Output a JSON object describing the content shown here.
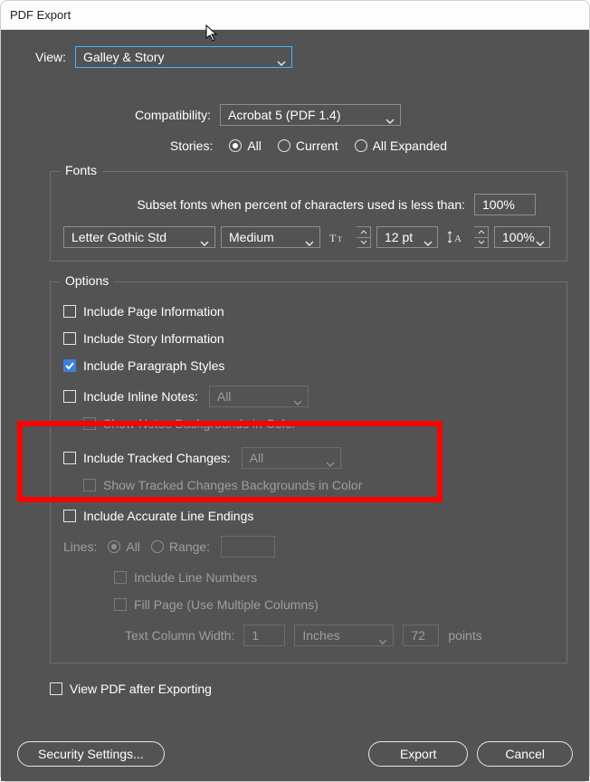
{
  "window": {
    "title": "PDF Export"
  },
  "view": {
    "label": "View:",
    "value": "Galley & Story"
  },
  "compatibility": {
    "label": "Compatibility:",
    "value": "Acrobat 5 (PDF 1.4)"
  },
  "stories": {
    "label": "Stories:",
    "options": {
      "all": "All",
      "current": "Current",
      "all_expanded": "All Expanded"
    },
    "selected": "all"
  },
  "fonts": {
    "legend": "Fonts",
    "subset_label": "Subset fonts when percent of characters used is less than:",
    "subset_value": "100%",
    "family": "Letter Gothic Std",
    "weight": "Medium",
    "size": "12 pt",
    "leading": "100%"
  },
  "options": {
    "legend": "Options",
    "include_page_info": {
      "label": "Include Page Information",
      "checked": false
    },
    "include_story_info": {
      "label": "Include Story Information",
      "checked": false
    },
    "include_para_styles": {
      "label": "Include Paragraph Styles",
      "checked": true
    },
    "include_inline_notes": {
      "label": "Include Inline Notes:",
      "checked": false,
      "value": "All"
    },
    "show_notes_bg": {
      "label": "Show Notes Backgrounds in Color",
      "checked": false
    },
    "include_tracked_changes": {
      "label": "Include Tracked Changes:",
      "checked": false,
      "value": "All"
    },
    "show_tc_bg": {
      "label": "Show Tracked Changes Backgrounds in Color",
      "checked": false
    },
    "include_accurate_endings": {
      "label": "Include Accurate Line Endings",
      "checked": false
    },
    "lines": {
      "label": "Lines:",
      "all": "All",
      "range": "Range:",
      "selected": "all",
      "range_value": ""
    },
    "include_line_numbers": {
      "label": "Include Line Numbers",
      "checked": false
    },
    "fill_page": {
      "label": "Fill Page (Use Multiple Columns)",
      "checked": false
    },
    "text_col_width": {
      "label": "Text Column Width:",
      "value": "1",
      "unit": "Inches",
      "points": "72",
      "points_label": "points"
    },
    "view_after_export": {
      "label": "View PDF after Exporting",
      "checked": false
    }
  },
  "footer": {
    "security": "Security Settings...",
    "export": "Export",
    "cancel": "Cancel"
  }
}
